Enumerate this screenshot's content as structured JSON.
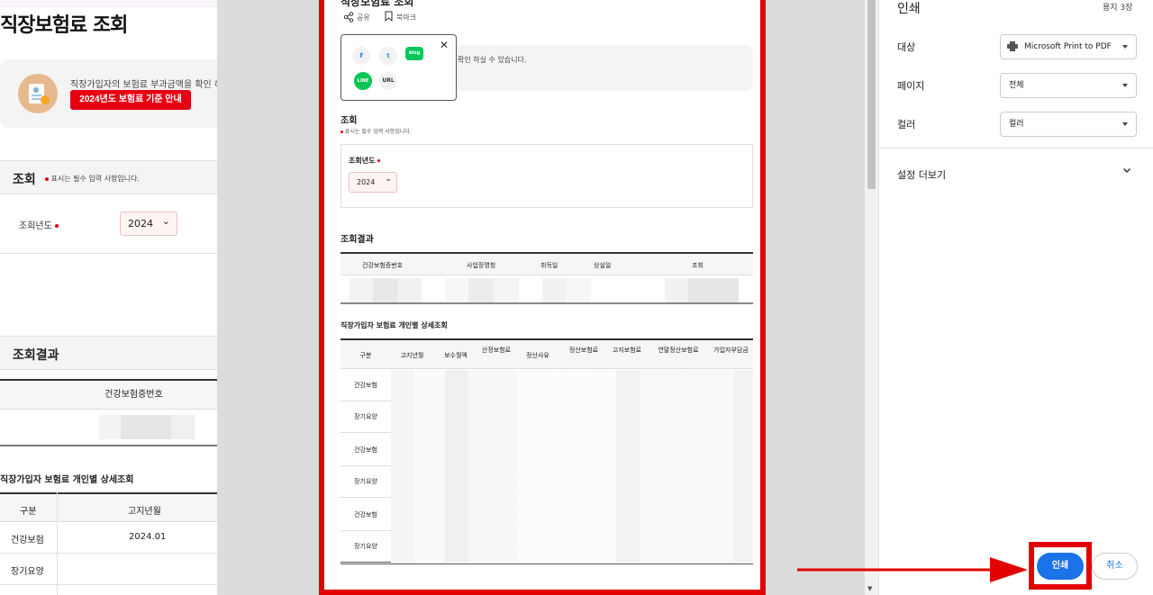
{
  "background_page": {
    "title": "직장보험료 조회",
    "notice_text": "직장가입자의 보험료 부과금액을 확인 하",
    "notice_button": "2024년도 보험료 기준 안내",
    "query_section_title": "조회",
    "required_note": "표시는 필수 입력 사항입니다.",
    "year_label": "조회년도",
    "year_value": "2024",
    "result_section_title": "조회결과",
    "result_col": "건강보험증번호",
    "detail_title": "직장가입자 보험료 개인별 상세조회",
    "detail_cols": [
      "구분",
      "고지년월"
    ],
    "detail_rows": [
      {
        "type": "건강보험",
        "month": "2024.01"
      },
      {
        "type": "장기요양",
        "month": ""
      }
    ]
  },
  "preview": {
    "page_title": "직장보험료 조회",
    "share_label": "공유",
    "bookmark_label": "북마크",
    "notice_text": "확인 하실 수 있습니다.",
    "share_popup": {
      "items": [
        {
          "icon": "facebook-icon",
          "label": "f",
          "color": "#1877f2"
        },
        {
          "icon": "twitter-icon",
          "label": "t",
          "color": "#1da1f2"
        },
        {
          "icon": "blog-icon",
          "label": "blog",
          "color": "#03c75a"
        },
        {
          "icon": "line-icon",
          "label": "LINE",
          "color": "#06c755"
        },
        {
          "icon": "url-icon",
          "label": "URL",
          "color": "#333333"
        }
      ],
      "close": "✕"
    },
    "query_title": "조회",
    "required_note": "표시는 필수 입력 사항입니다.",
    "year_label": "조회년도",
    "year_value": "2024",
    "result_title": "조회결과",
    "result_cols": [
      "건강보험증번호",
      "사업장명칭",
      "취득일",
      "상실일",
      "조회"
    ],
    "detail_title": "직장가입자 보험료 개인별 상세조회",
    "detail_cols": [
      "구분",
      "고지년월",
      "보수월액",
      "산정보험료",
      "정산사유",
      "정산보험료",
      "고지보험료",
      "연말정산보험료",
      "가입자부담금"
    ],
    "detail_rows": [
      "건강보험",
      "장기요양",
      "건강보험",
      "장기요양",
      "건강보험",
      "장기요양"
    ]
  },
  "print_panel": {
    "title": "인쇄",
    "pages": "용지 3장",
    "destination_label": "대상",
    "destination_value": "Microsoft Print to PDF",
    "pages_label": "페이지",
    "pages_value": "전체",
    "color_label": "컬러",
    "color_value": "컬러",
    "more_settings": "설정 더보기",
    "print_button": "인쇄",
    "cancel_button": "취소"
  },
  "annotation_color": "#e30000"
}
